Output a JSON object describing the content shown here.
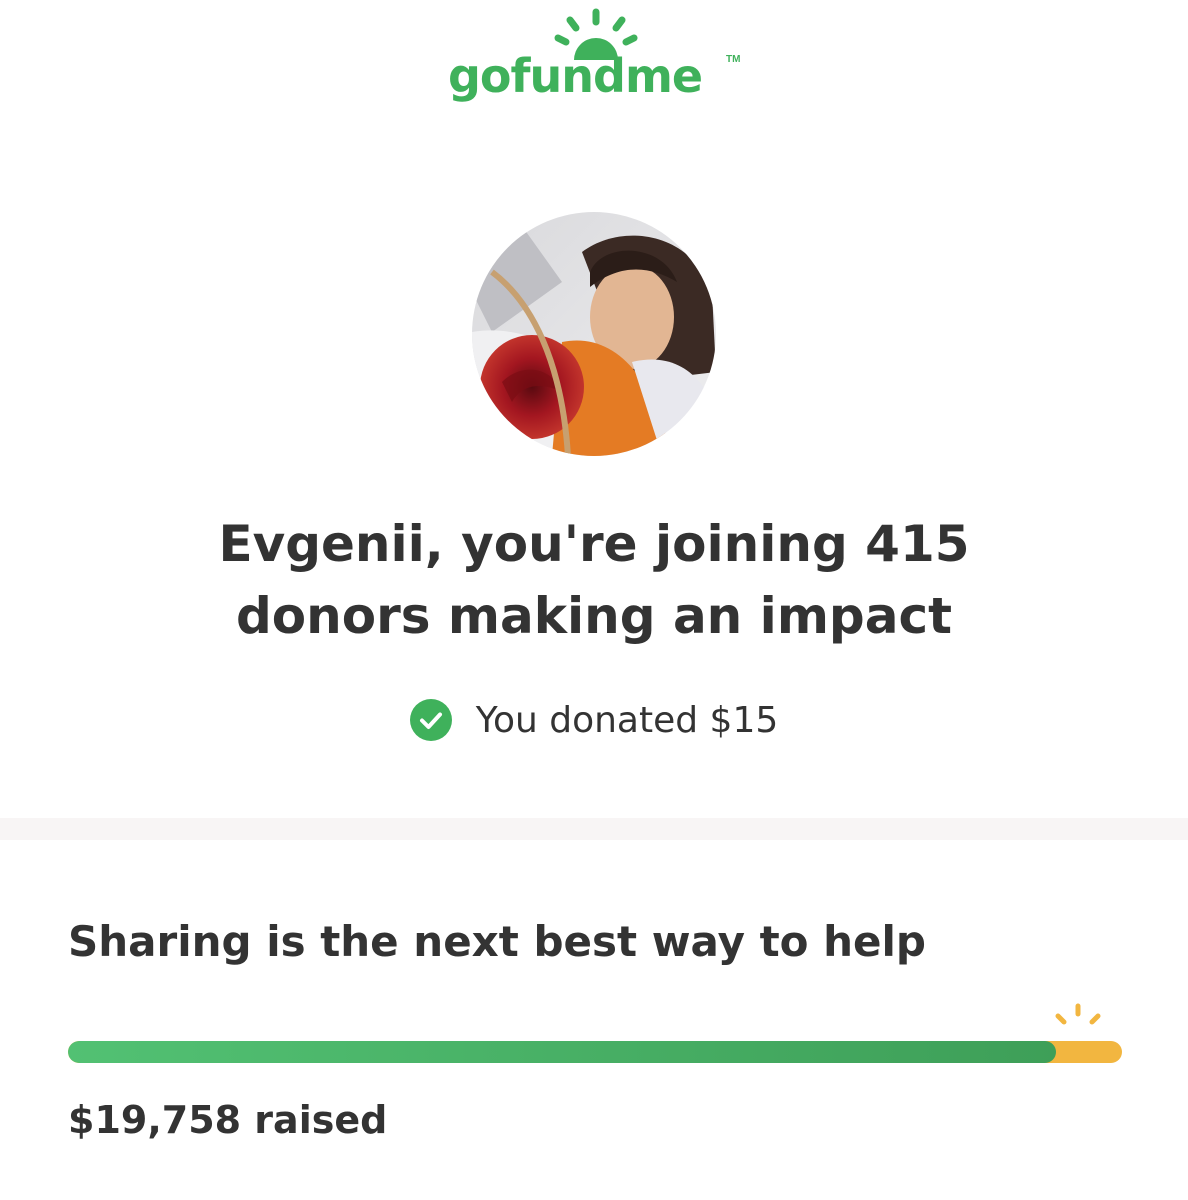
{
  "brand": {
    "wordmark": "gofundme",
    "trademark": "TM",
    "color": "#3fb15b",
    "logo_icon": "sun-icon"
  },
  "avatar": {
    "description_icon": "fundraiser-avatar"
  },
  "headline": {
    "line1": "Evgenii, you're joining 415",
    "line2": "donors making an impact"
  },
  "donation": {
    "status_icon": "check-circle-icon",
    "text": "You donated $15"
  },
  "share": {
    "heading": "Sharing is the next best way to help"
  },
  "progress": {
    "fraction_raised": 0.937,
    "fill_color": "#47ad62",
    "remaining_color": "#f2b640",
    "icon": "sparkle-icon"
  },
  "raised": {
    "text": "$19,758 raised"
  }
}
